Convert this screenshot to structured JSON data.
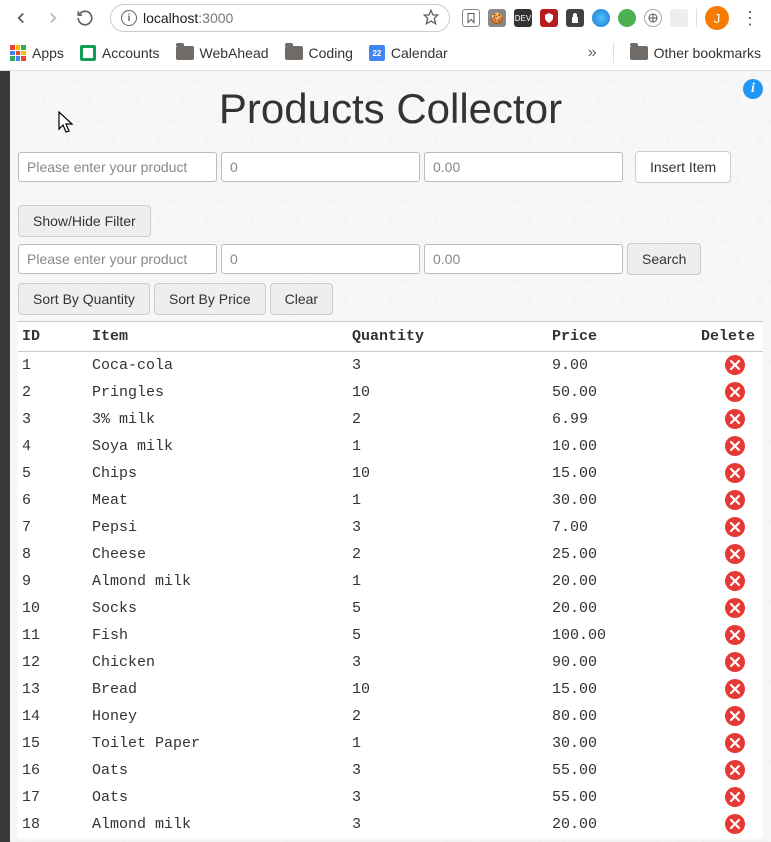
{
  "browser": {
    "url_host": "localhost",
    "url_port": ":3000",
    "avatar_letter": "J",
    "bookmarks": {
      "apps": "Apps",
      "accounts": "Accounts",
      "webahead": "WebAhead",
      "coding": "Coding",
      "calendar": "Calendar",
      "calendar_day": "22",
      "overflow": "»",
      "other": "Other bookmarks"
    }
  },
  "page": {
    "title": "Products Collector"
  },
  "insert": {
    "product_placeholder": "Please enter your product",
    "qty_placeholder": "0",
    "price_placeholder": "0.00",
    "button": "Insert Item"
  },
  "filter": {
    "toggle": "Show/Hide Filter",
    "product_placeholder": "Please enter your product",
    "qty_placeholder": "0",
    "price_placeholder": "0.00",
    "search": "Search",
    "sort_qty": "Sort By Quantity",
    "sort_price": "Sort By Price",
    "clear": "Clear"
  },
  "table": {
    "headers": {
      "id": "ID",
      "item": "Item",
      "qty": "Quantity",
      "price": "Price",
      "del": "Delete"
    },
    "rows": [
      {
        "id": "1",
        "item": "Coca-cola",
        "qty": "3",
        "price": "9.00"
      },
      {
        "id": "2",
        "item": "Pringles",
        "qty": "10",
        "price": "50.00"
      },
      {
        "id": "3",
        "item": "3% milk",
        "qty": "2",
        "price": "6.99"
      },
      {
        "id": "4",
        "item": "Soya milk",
        "qty": "1",
        "price": "10.00"
      },
      {
        "id": "5",
        "item": "Chips",
        "qty": "10",
        "price": "15.00"
      },
      {
        "id": "6",
        "item": "Meat",
        "qty": "1",
        "price": "30.00"
      },
      {
        "id": "7",
        "item": "Pepsi",
        "qty": "3",
        "price": "7.00"
      },
      {
        "id": "8",
        "item": "Cheese",
        "qty": "2",
        "price": "25.00"
      },
      {
        "id": "9",
        "item": "Almond milk",
        "qty": "1",
        "price": "20.00"
      },
      {
        "id": "10",
        "item": "Socks",
        "qty": "5",
        "price": "20.00"
      },
      {
        "id": "11",
        "item": "Fish",
        "qty": "5",
        "price": "100.00"
      },
      {
        "id": "12",
        "item": "Chicken",
        "qty": "3",
        "price": "90.00"
      },
      {
        "id": "13",
        "item": "Bread",
        "qty": "10",
        "price": "15.00"
      },
      {
        "id": "14",
        "item": "Honey",
        "qty": "2",
        "price": "80.00"
      },
      {
        "id": "15",
        "item": "Toilet Paper",
        "qty": "1",
        "price": "30.00"
      },
      {
        "id": "16",
        "item": "Oats",
        "qty": "3",
        "price": "55.00"
      },
      {
        "id": "17",
        "item": "Oats",
        "qty": "3",
        "price": "55.00"
      },
      {
        "id": "18",
        "item": "Almond milk",
        "qty": "3",
        "price": "20.00"
      }
    ]
  }
}
